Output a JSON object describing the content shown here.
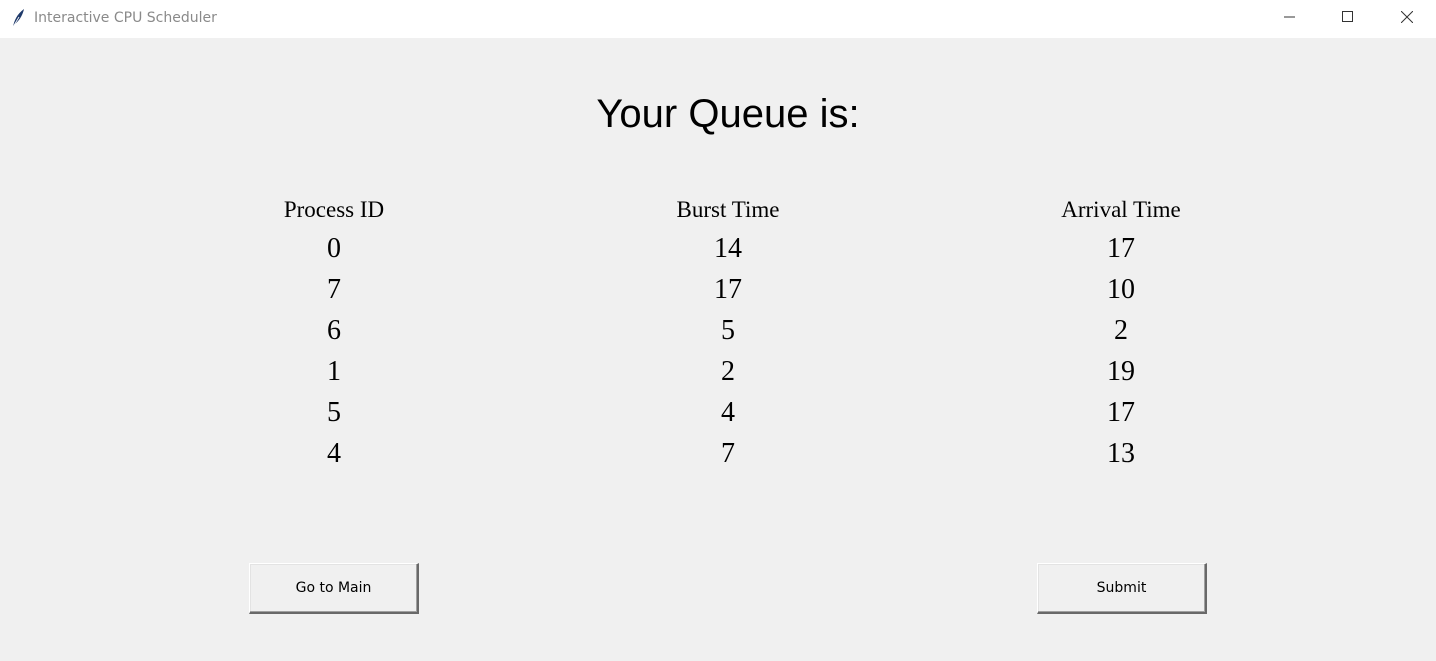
{
  "window": {
    "title": "Interactive CPU Scheduler",
    "icon": "feather-icon",
    "controls": [
      "minimize-icon",
      "maximize-icon",
      "close-icon"
    ]
  },
  "main": {
    "heading": "Your Queue is:",
    "columns": {
      "process_id": {
        "header": "Process ID",
        "values": [
          "0",
          "7",
          "6",
          "1",
          "5",
          "4"
        ]
      },
      "burst_time": {
        "header": "Burst Time",
        "values": [
          "14",
          "17",
          "5",
          "2",
          "4",
          "7"
        ]
      },
      "arrival_time": {
        "header": "Arrival Time",
        "values": [
          "17",
          "10",
          "2",
          "19",
          "17",
          "13"
        ]
      }
    }
  },
  "buttons": {
    "go_to_main": "Go to Main",
    "submit": "Submit"
  }
}
